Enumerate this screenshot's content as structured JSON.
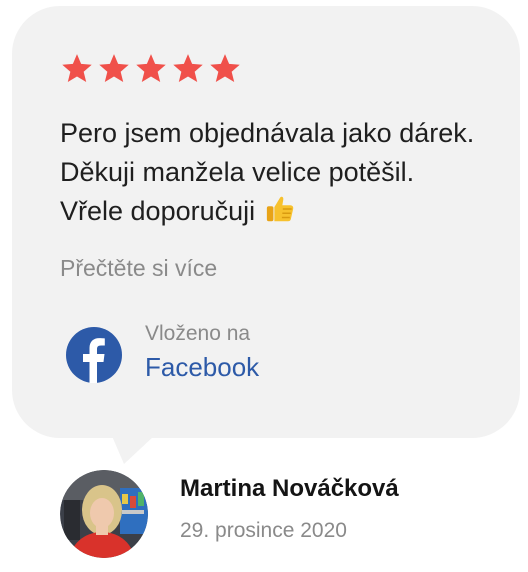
{
  "review": {
    "rating": 5,
    "rating_max": 5,
    "star_color": "#f0504a",
    "text": "Pero jsem objednávala jako dárek. Děkuji manžela velice potěšil. Vřele doporučuji",
    "emoji": "thumbs-up-icon",
    "read_more": "Přečtěte si více"
  },
  "source": {
    "posted_on_label": "Vloženo na",
    "platform_name": "Facebook",
    "platform_icon": "facebook-logo-icon",
    "brand_color": "#2d5aa8"
  },
  "author": {
    "name": "Martina Nováčková",
    "date": "29. prosince 2020"
  }
}
